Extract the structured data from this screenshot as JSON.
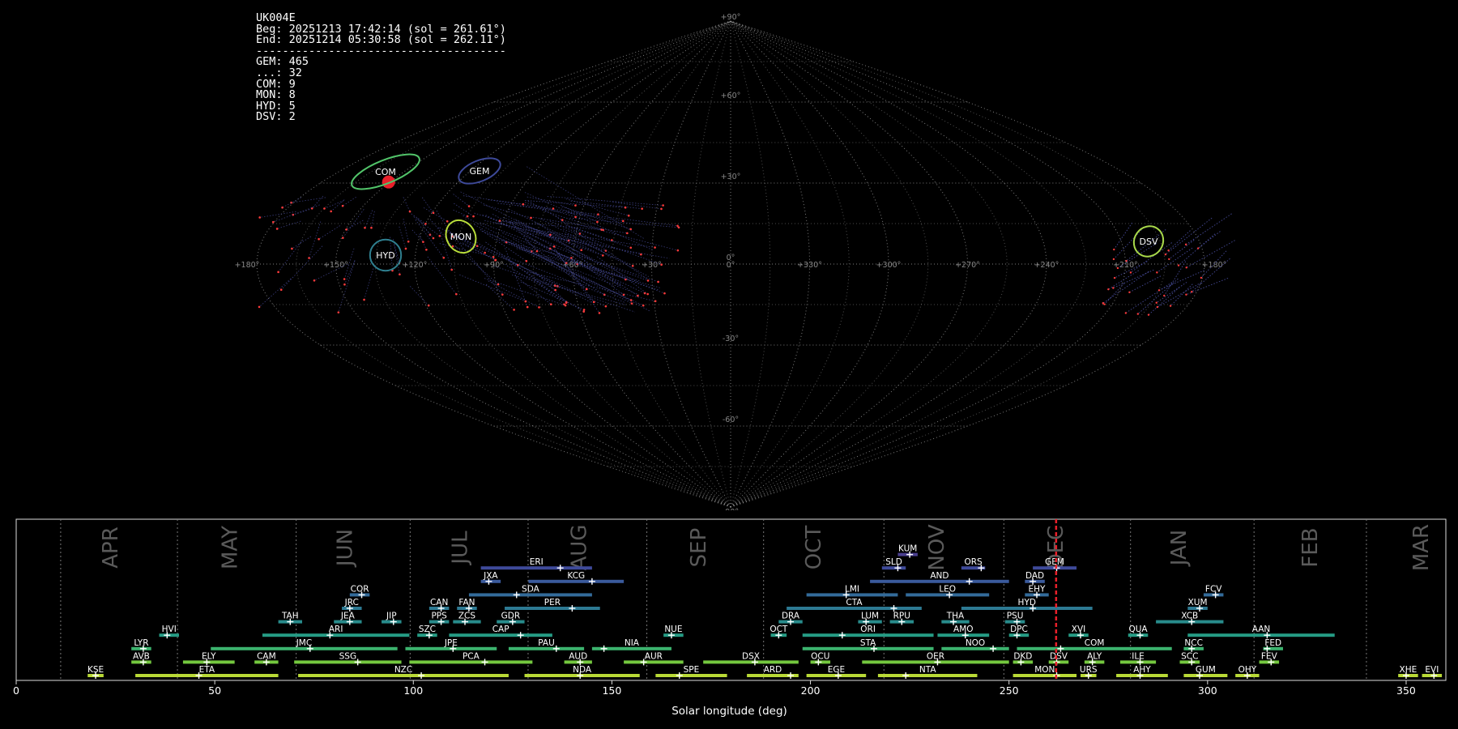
{
  "info": {
    "station": "UK004E",
    "beg": "Beg: 20251213 17:42:14 (sol = 261.61°)",
    "end": "End: 20251214 05:30:58 (sol = 262.11°)",
    "separator": "--------------------------------------",
    "counts": [
      {
        "code": "GEM",
        "count": "465"
      },
      {
        "code": "...",
        "count": "32"
      },
      {
        "code": "COM",
        "count": "9"
      },
      {
        "code": "MON",
        "count": "8"
      },
      {
        "code": "HYD",
        "count": "5"
      },
      {
        "code": "DSV",
        "count": "2"
      }
    ]
  },
  "colors": {
    "grid": "#9a9a9a",
    "trail": "#4b4fa0",
    "meteor_dot": "#ff3b3b",
    "marker": "#e8202a"
  },
  "chart_data": [
    {
      "type": "scatter",
      "projection": "sinusoidal",
      "lat_ticks": [
        "+90°",
        "+60°",
        "+30°",
        "0°",
        "-30°",
        "-60°",
        "-90°"
      ],
      "lon_ticks": [
        "+180°",
        "+150°",
        "+120°",
        "+90°",
        "+60°",
        "+30°",
        "0°",
        "+330°",
        "+300°",
        "+270°",
        "+240°",
        "+210°",
        "+180°"
      ],
      "radiants": [
        {
          "code": "COM",
          "lon": 154,
          "lat": 30,
          "color": "#52c56a",
          "w": 28,
          "h": 9
        },
        {
          "code": "GEM",
          "lon": 113,
          "lat": 31,
          "color": "#3e4a9a",
          "w": 17,
          "h": 8
        },
        {
          "code": "MON",
          "lon": 101,
          "lat": 9,
          "color": "#b8dc3a",
          "w": 11,
          "h": 13
        },
        {
          "code": "HYD",
          "lon": 127,
          "lat": 3,
          "color": "#2f7f8f",
          "w": 12,
          "h": 12
        },
        {
          "code": "DSV",
          "lon": 195,
          "lat": 7,
          "color": "#a9d94a",
          "w": 11,
          "h": 12
        }
      ]
    },
    {
      "type": "bar",
      "orientation": "horizontal",
      "xlabel": "Solar longitude (deg)",
      "xlim": [
        0,
        360
      ],
      "xticks": [
        0,
        50,
        100,
        150,
        200,
        250,
        300,
        350
      ],
      "current_sol": 261.86,
      "months": [
        {
          "name": "APR",
          "start": 11.2,
          "center": 24
        },
        {
          "name": "MAY",
          "start": 40.6,
          "center": 54
        },
        {
          "name": "JUN",
          "start": 70.5,
          "center": 83
        },
        {
          "name": "JUL",
          "start": 99.2,
          "center": 112
        },
        {
          "name": "AUG",
          "start": 128.9,
          "center": 142
        },
        {
          "name": "SEP",
          "start": 158.8,
          "center": 172
        },
        {
          "name": "OCT",
          "start": 188.2,
          "center": 201
        },
        {
          "name": "NOV",
          "start": 218.5,
          "center": 232
        },
        {
          "name": "DEC",
          "start": 248.7,
          "center": 262
        },
        {
          "name": "JAN",
          "start": 280.6,
          "center": 293
        },
        {
          "name": "FEB",
          "start": 311.7,
          "center": 326
        },
        {
          "name": "MAR",
          "start": 340.0,
          "center": 354
        }
      ],
      "showers": [
        {
          "code": "KUM",
          "start": 222,
          "end": 227,
          "peak": 225,
          "row": 11,
          "color": "#4a3f8f"
        },
        {
          "code": "ERI",
          "start": 117,
          "end": 145,
          "peak": 137,
          "row": 10,
          "color": "#3e4a9a"
        },
        {
          "code": "SLD",
          "start": 218,
          "end": 224,
          "peak": 222,
          "row": 10,
          "color": "#3e4a9a"
        },
        {
          "code": "ORS",
          "start": 238,
          "end": 244,
          "peak": 243,
          "row": 10,
          "color": "#3e4a9a"
        },
        {
          "code": "GEM",
          "start": 256,
          "end": 267,
          "peak": 262,
          "row": 10,
          "color": "#3e4a9a"
        },
        {
          "code": "JXA",
          "start": 117,
          "end": 122,
          "peak": 119,
          "row": 9,
          "color": "#3a5a9c"
        },
        {
          "code": "KCG",
          "start": 129,
          "end": 153,
          "peak": 145,
          "row": 9,
          "color": "#3a5a9c"
        },
        {
          "code": "AND",
          "start": 215,
          "end": 250,
          "peak": 240,
          "row": 9,
          "color": "#3a5a9c"
        },
        {
          "code": "DAD",
          "start": 254,
          "end": 259,
          "peak": 256,
          "row": 9,
          "color": "#3a5a9c"
        },
        {
          "code": "COR",
          "start": 84,
          "end": 89,
          "peak": 87,
          "row": 8,
          "color": "#336b9a"
        },
        {
          "code": "SDA",
          "start": 114,
          "end": 145,
          "peak": 126,
          "row": 8,
          "color": "#336b9a"
        },
        {
          "code": "LMI",
          "start": 199,
          "end": 222,
          "peak": 209,
          "row": 8,
          "color": "#336b9a"
        },
        {
          "code": "LEO",
          "start": 224,
          "end": 245,
          "peak": 235,
          "row": 8,
          "color": "#336b9a"
        },
        {
          "code": "EHY",
          "start": 254,
          "end": 260,
          "peak": 257,
          "row": 8,
          "color": "#336b9a"
        },
        {
          "code": "FCV",
          "start": 299,
          "end": 304,
          "peak": 302,
          "row": 8,
          "color": "#336b9a"
        },
        {
          "code": "JRC",
          "start": 82,
          "end": 87,
          "peak": 84,
          "row": 7,
          "color": "#2d7a93"
        },
        {
          "code": "CAN",
          "start": 104,
          "end": 109,
          "peak": 107,
          "row": 7,
          "color": "#2d7a93"
        },
        {
          "code": "FAN",
          "start": 111,
          "end": 116,
          "peak": 114,
          "row": 7,
          "color": "#2d7a93"
        },
        {
          "code": "PER",
          "start": 123,
          "end": 147,
          "peak": 140,
          "row": 7,
          "color": "#2d7a93"
        },
        {
          "code": "CTA",
          "start": 194,
          "end": 228,
          "peak": 221,
          "row": 7,
          "color": "#2d7a93"
        },
        {
          "code": "HYD",
          "start": 238,
          "end": 271,
          "peak": 256,
          "row": 7,
          "color": "#2d7a93"
        },
        {
          "code": "XUM",
          "start": 295,
          "end": 300,
          "peak": 298,
          "row": 7,
          "color": "#2d7a93"
        },
        {
          "code": "TAH",
          "start": 66,
          "end": 72,
          "peak": 69,
          "row": 6,
          "color": "#288c8c"
        },
        {
          "code": "JEA",
          "start": 80,
          "end": 87,
          "peak": 84,
          "row": 6,
          "color": "#288c8c"
        },
        {
          "code": "JIP",
          "start": 92,
          "end": 97,
          "peak": 95,
          "row": 6,
          "color": "#288c8c"
        },
        {
          "code": "PPS",
          "start": 104,
          "end": 109,
          "peak": 107,
          "row": 6,
          "color": "#288c8c"
        },
        {
          "code": "ZCS",
          "start": 110,
          "end": 117,
          "peak": 113,
          "row": 6,
          "color": "#288c8c"
        },
        {
          "code": "GDR",
          "start": 121,
          "end": 128,
          "peak": 125,
          "row": 6,
          "color": "#288c8c"
        },
        {
          "code": "DRA",
          "start": 192,
          "end": 198,
          "peak": 195,
          "row": 6,
          "color": "#288c8c"
        },
        {
          "code": "LUM",
          "start": 212,
          "end": 218,
          "peak": 214,
          "row": 6,
          "color": "#288c8c"
        },
        {
          "code": "RPU",
          "start": 220,
          "end": 226,
          "peak": 223,
          "row": 6,
          "color": "#288c8c"
        },
        {
          "code": "THA",
          "start": 233,
          "end": 240,
          "peak": 236,
          "row": 6,
          "color": "#288c8c"
        },
        {
          "code": "PSU",
          "start": 249,
          "end": 254,
          "peak": 252,
          "row": 6,
          "color": "#288c8c"
        },
        {
          "code": "XCB",
          "start": 287,
          "end": 304,
          "peak": 296,
          "row": 6,
          "color": "#288c8c"
        },
        {
          "code": "HVI",
          "start": 36,
          "end": 41,
          "peak": 38,
          "row": 5,
          "color": "#259c85"
        },
        {
          "code": "ARI",
          "start": 62,
          "end": 99,
          "peak": 79,
          "row": 5,
          "color": "#259c85"
        },
        {
          "code": "SZC",
          "start": 101,
          "end": 106,
          "peak": 104,
          "row": 5,
          "color": "#259c85"
        },
        {
          "code": "CAP",
          "start": 109,
          "end": 135,
          "peak": 127,
          "row": 5,
          "color": "#259c85"
        },
        {
          "code": "NUE",
          "start": 163,
          "end": 168,
          "peak": 165,
          "row": 5,
          "color": "#259c85"
        },
        {
          "code": "OCT",
          "start": 190,
          "end": 194,
          "peak": 192,
          "row": 5,
          "color": "#259c85"
        },
        {
          "code": "ORI",
          "start": 198,
          "end": 231,
          "peak": 208,
          "row": 5,
          "color": "#259c85"
        },
        {
          "code": "AMO",
          "start": 232,
          "end": 245,
          "peak": 239,
          "row": 5,
          "color": "#259c85"
        },
        {
          "code": "DPC",
          "start": 250,
          "end": 255,
          "peak": 252,
          "row": 5,
          "color": "#259c85"
        },
        {
          "code": "XVI",
          "start": 265,
          "end": 270,
          "peak": 268,
          "row": 5,
          "color": "#259c85"
        },
        {
          "code": "QUA",
          "start": 280,
          "end": 285,
          "peak": 283,
          "row": 5,
          "color": "#259c85"
        },
        {
          "code": "AAN",
          "start": 295,
          "end": 332,
          "peak": 315,
          "row": 5,
          "color": "#259c85"
        },
        {
          "code": "LYR",
          "start": 29,
          "end": 34,
          "peak": 32,
          "row": 4,
          "color": "#3cb36e"
        },
        {
          "code": "JMC",
          "start": 49,
          "end": 96,
          "peak": 74,
          "row": 4,
          "color": "#3cb36e"
        },
        {
          "code": "JPE",
          "start": 98,
          "end": 121,
          "peak": 110,
          "row": 4,
          "color": "#3cb36e"
        },
        {
          "code": "PAU",
          "start": 124,
          "end": 143,
          "peak": 136,
          "row": 4,
          "color": "#3cb36e"
        },
        {
          "code": "NIA",
          "start": 145,
          "end": 165,
          "peak": 148,
          "row": 4,
          "color": "#3cb36e"
        },
        {
          "code": "STA",
          "start": 198,
          "end": 231,
          "peak": 216,
          "row": 4,
          "color": "#3cb36e"
        },
        {
          "code": "NOO",
          "start": 233,
          "end": 250,
          "peak": 246,
          "row": 4,
          "color": "#3cb36e"
        },
        {
          "code": "COM",
          "start": 252,
          "end": 291,
          "peak": 263,
          "row": 4,
          "color": "#3cb36e"
        },
        {
          "code": "NCC",
          "start": 294,
          "end": 299,
          "peak": 296,
          "row": 4,
          "color": "#3cb36e"
        },
        {
          "code": "FED",
          "start": 314,
          "end": 319,
          "peak": 315,
          "row": 4,
          "color": "#3cb36e"
        },
        {
          "code": "AVB",
          "start": 29,
          "end": 34,
          "peak": 32,
          "row": 3,
          "color": "#74c83f"
        },
        {
          "code": "ELY",
          "start": 42,
          "end": 55,
          "peak": 48,
          "row": 3,
          "color": "#74c83f"
        },
        {
          "code": "CAM",
          "start": 60,
          "end": 66,
          "peak": 63,
          "row": 3,
          "color": "#74c83f"
        },
        {
          "code": "SSG",
          "start": 70,
          "end": 97,
          "peak": 86,
          "row": 3,
          "color": "#74c83f"
        },
        {
          "code": "PCA",
          "start": 99,
          "end": 130,
          "peak": 118,
          "row": 3,
          "color": "#74c83f"
        },
        {
          "code": "AUD",
          "start": 138,
          "end": 145,
          "peak": 142,
          "row": 3,
          "color": "#74c83f"
        },
        {
          "code": "AUR",
          "start": 153,
          "end": 168,
          "peak": 158,
          "row": 3,
          "color": "#74c83f"
        },
        {
          "code": "DSX",
          "start": 173,
          "end": 197,
          "peak": 186,
          "row": 3,
          "color": "#74c83f"
        },
        {
          "code": "OCU",
          "start": 200,
          "end": 205,
          "peak": 202,
          "row": 3,
          "color": "#74c83f"
        },
        {
          "code": "OER",
          "start": 213,
          "end": 250,
          "peak": 232,
          "row": 3,
          "color": "#74c83f"
        },
        {
          "code": "DKD",
          "start": 251,
          "end": 256,
          "peak": 253,
          "row": 3,
          "color": "#74c83f"
        },
        {
          "code": "DSV",
          "start": 260,
          "end": 265,
          "peak": 262,
          "row": 3,
          "color": "#74c83f"
        },
        {
          "code": "ALY",
          "start": 269,
          "end": 274,
          "peak": 271,
          "row": 3,
          "color": "#74c83f"
        },
        {
          "code": "ILE",
          "start": 278,
          "end": 287,
          "peak": 283,
          "row": 3,
          "color": "#74c83f"
        },
        {
          "code": "SCC",
          "start": 293,
          "end": 298,
          "peak": 296,
          "row": 3,
          "color": "#74c83f"
        },
        {
          "code": "FEV",
          "start": 313,
          "end": 318,
          "peak": 316,
          "row": 3,
          "color": "#74c83f"
        },
        {
          "code": "KSE",
          "start": 18,
          "end": 22,
          "peak": 20,
          "row": 2,
          "color": "#b9d936"
        },
        {
          "code": "ETA",
          "start": 30,
          "end": 66,
          "peak": 46,
          "row": 2,
          "color": "#b9d936"
        },
        {
          "code": "NZC",
          "start": 71,
          "end": 124,
          "peak": 102,
          "row": 2,
          "color": "#b9d936"
        },
        {
          "code": "NDA",
          "start": 128,
          "end": 157,
          "peak": 142,
          "row": 2,
          "color": "#b9d936"
        },
        {
          "code": "SPE",
          "start": 161,
          "end": 179,
          "peak": 167,
          "row": 2,
          "color": "#b9d936"
        },
        {
          "code": "ARD",
          "start": 184,
          "end": 197,
          "peak": 195,
          "row": 2,
          "color": "#b9d936"
        },
        {
          "code": "EGE",
          "start": 199,
          "end": 214,
          "peak": 207,
          "row": 2,
          "color": "#b9d936"
        },
        {
          "code": "NTA",
          "start": 217,
          "end": 242,
          "peak": 224,
          "row": 2,
          "color": "#b9d936"
        },
        {
          "code": "MON",
          "start": 251,
          "end": 267,
          "peak": 262,
          "row": 2,
          "color": "#b9d936"
        },
        {
          "code": "URS",
          "start": 268,
          "end": 272,
          "peak": 270,
          "row": 2,
          "color": "#b9d936"
        },
        {
          "code": "AHY",
          "start": 277,
          "end": 290,
          "peak": 283,
          "row": 2,
          "color": "#b9d936"
        },
        {
          "code": "GUM",
          "start": 294,
          "end": 305,
          "peak": 298,
          "row": 2,
          "color": "#b9d936"
        },
        {
          "code": "OHY",
          "start": 307,
          "end": 313,
          "peak": 310,
          "row": 2,
          "color": "#b9d936"
        },
        {
          "code": "XHE",
          "start": 348,
          "end": 353,
          "peak": 350,
          "row": 2,
          "color": "#b9d936"
        },
        {
          "code": "EVI",
          "start": 354,
          "end": 359,
          "peak": 357,
          "row": 2,
          "color": "#b9d936"
        }
      ]
    }
  ]
}
